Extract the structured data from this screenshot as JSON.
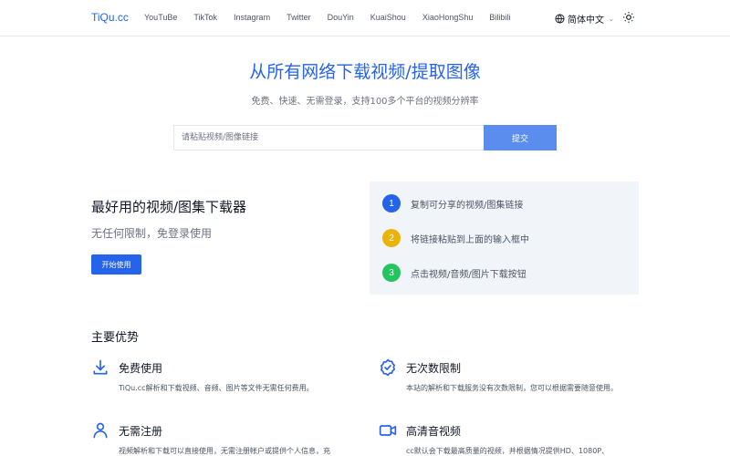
{
  "nav": {
    "logo": "TiQu.cc",
    "links": [
      "YouTuBe",
      "TikTok",
      "Instagram",
      "Twitter",
      "DouYin",
      "KuaiShou",
      "XiaoHongShu",
      "Bilibili"
    ],
    "language": "简体中文",
    "icons": {
      "language": "globe-icon",
      "theme": "sun-icon"
    }
  },
  "hero": {
    "title": "从所有网络下载视频/提取图像",
    "subtitle": "免费、快速、无需登录，支持100多个平台的视频分辨率",
    "input_placeholder": "请粘贴视频/图像链接",
    "input_value": "",
    "submit_label": "提交"
  },
  "feature": {
    "title": "最好用的视频/图集下载器",
    "subtitle": "无任何限制，免登录使用",
    "start_label": "开始使用"
  },
  "steps": [
    {
      "num": "1",
      "text": "复制可分享的视频/图集链接",
      "color": "#2563eb"
    },
    {
      "num": "2",
      "text": "将链接粘贴到上面的输入框中",
      "color": "#eab308"
    },
    {
      "num": "3",
      "text": "点击视频/音频/图片下载按钮",
      "color": "#22c55e"
    }
  ],
  "advantages": {
    "title": "主要优势",
    "items": [
      {
        "title": "免费使用",
        "desc": "TiQu.cc解析和下载视频、音频、图片等文件无需任何费用。",
        "icon": "download-icon"
      },
      {
        "title": "无次数限制",
        "desc": "本站的解析和下载服务没有次数限制，您可以根据需要随意使用。",
        "icon": "badge-check-icon"
      },
      {
        "title": "无需注册",
        "desc": "视频解析和下载可以直接使用，无需注册帐户或提供个人信息，充",
        "icon": "user-icon"
      },
      {
        "title": "高清音视频",
        "desc": "cc默认会下载最高质量的视频，并根据情况提供HD、1080P、",
        "icon": "video-camera-icon"
      }
    ]
  },
  "colors": {
    "accent": "#2563eb",
    "submit": "#5b8def",
    "steps_bg": "#f1f4f8"
  }
}
